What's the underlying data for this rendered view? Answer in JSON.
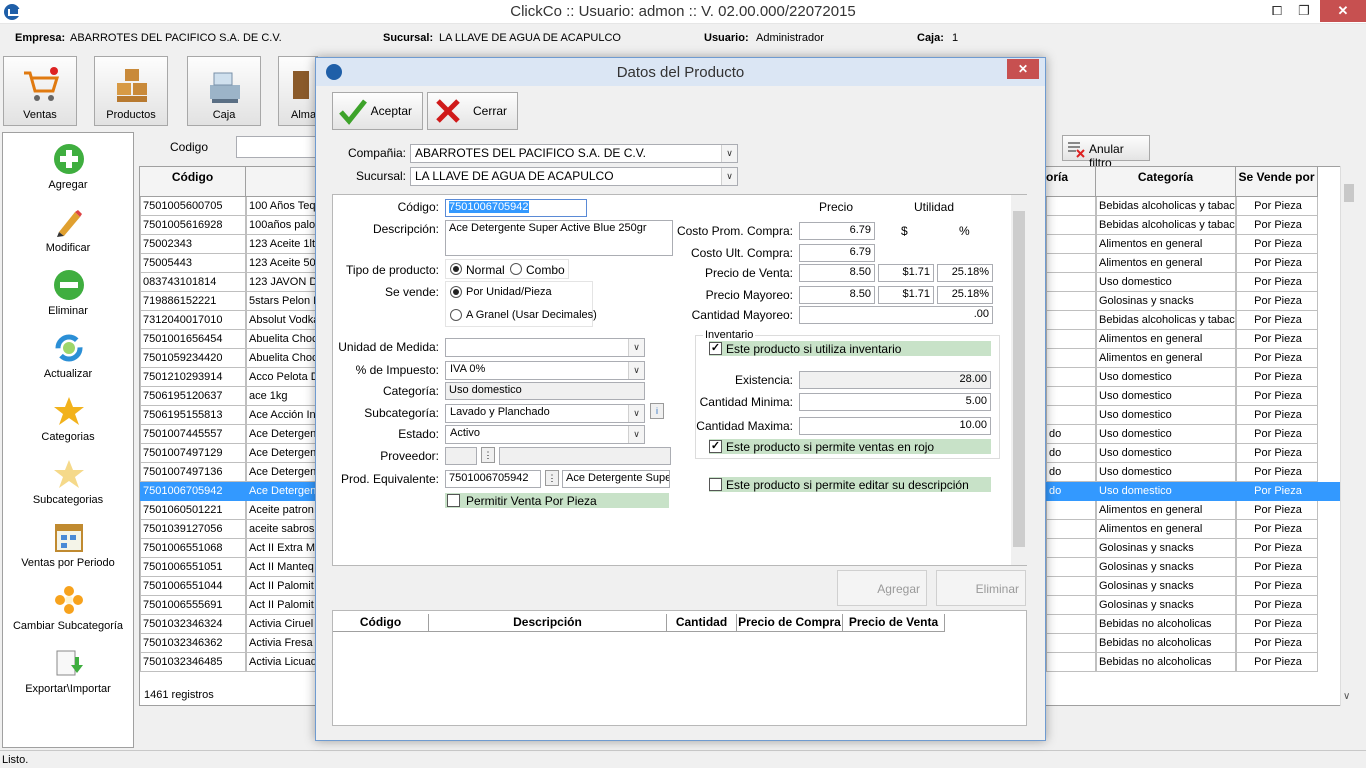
{
  "window": {
    "title": "ClickCo :: Usuario: admon :: V. 02.00.000/22072015",
    "minimize": "⧠",
    "maximize": "❐",
    "close": "✕"
  },
  "infobar": {
    "empresa_label": "Empresa:",
    "empresa": "ABARROTES DEL PACIFICO S.A. DE C.V.",
    "sucursal_label": "Sucursal:",
    "sucursal": "LA LLAVE DE AGUA DE ACAPULCO",
    "usuario_label": "Usuario:",
    "usuario": "Administrador",
    "caja_label": "Caja:",
    "caja": "1"
  },
  "toolbar": {
    "ventas": "Ventas",
    "productos": "Productos",
    "caja": "Caja",
    "almacen": "Alma"
  },
  "sidebar": [
    {
      "label": "Agregar",
      "icon": "plus-circle-icon"
    },
    {
      "label": "Modificar",
      "icon": "pencil-icon"
    },
    {
      "label": "Eliminar",
      "icon": "minus-circle-icon"
    },
    {
      "label": "Actualizar",
      "icon": "refresh-icon"
    },
    {
      "label": "Categorias",
      "icon": "star-icon"
    },
    {
      "label": "Subcategorias",
      "icon": "star-faded-icon"
    },
    {
      "label": "Ventas por Periodo",
      "icon": "calendar-icon"
    },
    {
      "label": "Cambiar Subcategoría",
      "icon": "flower-icon"
    },
    {
      "label": "Exportar\\Importar",
      "icon": "export-icon"
    }
  ],
  "filter": {
    "codigo_label": "Codigo",
    "anular": "Anular filtro"
  },
  "grid": {
    "headers": {
      "codigo": "Código",
      "categoria_partial": "oría",
      "categoria": "Categoría",
      "vende": "Se Vende por"
    },
    "rows": [
      {
        "codigo": "7501005600705",
        "desc": "100 Años Teq",
        "mid": "",
        "cat": "Bebidas alcoholicas y tabaco",
        "vende": "Por Pieza"
      },
      {
        "codigo": "7501005616928",
        "desc": "100años palor",
        "mid": "",
        "cat": "Bebidas alcoholicas y tabaco",
        "vende": "Por Pieza"
      },
      {
        "codigo": "75002343",
        "desc": "123 Aceite 1lt",
        "mid": "",
        "cat": "Alimentos en general",
        "vende": "Por Pieza"
      },
      {
        "codigo": "75005443",
        "desc": "123 Aceite 500",
        "mid": "",
        "cat": "Alimentos en general",
        "vende": "Por Pieza"
      },
      {
        "codigo": "083743101814",
        "desc": "123 JAVON DE",
        "mid": "",
        "cat": "Uso domestico",
        "vende": "Por Pieza"
      },
      {
        "codigo": "719886152221",
        "desc": "5stars Pelon P",
        "mid": "",
        "cat": "Golosinas y snacks",
        "vende": "Por Pieza"
      },
      {
        "codigo": "7312040017010",
        "desc": "Absolut Vodka",
        "mid": "",
        "cat": "Bebidas alcoholicas y tabaco",
        "vende": "Por Pieza"
      },
      {
        "codigo": "7501001656454",
        "desc": "Abuelita Choc",
        "mid": "",
        "cat": "Alimentos en general",
        "vende": "Por Pieza"
      },
      {
        "codigo": "7501059234420",
        "desc": "Abuelita Choc",
        "mid": "",
        "cat": "Alimentos en general",
        "vende": "Por Pieza"
      },
      {
        "codigo": "7501210293914",
        "desc": "Acco Pelota De",
        "mid": "",
        "cat": "Uso domestico",
        "vende": "Por Pieza"
      },
      {
        "codigo": "7506195120637",
        "desc": "ace 1kg",
        "mid": "",
        "cat": "Uso domestico",
        "vende": "Por Pieza"
      },
      {
        "codigo": "7506195155813",
        "desc": "Ace Acción Ins",
        "mid": "",
        "cat": "Uso domestico",
        "vende": "Por Pieza"
      },
      {
        "codigo": "7501007445557",
        "desc": "Ace Detergent",
        "mid": "do",
        "cat": "Uso domestico",
        "vende": "Por Pieza"
      },
      {
        "codigo": "7501007497129",
        "desc": "Ace Detergent",
        "mid": "do",
        "cat": "Uso domestico",
        "vende": "Por Pieza"
      },
      {
        "codigo": "7501007497136",
        "desc": "Ace Detergent",
        "mid": "do",
        "cat": "Uso domestico",
        "vende": "Por Pieza"
      },
      {
        "codigo": "7501006705942",
        "desc": "Ace Detergent",
        "mid": "do",
        "cat": "Uso domestico",
        "vende": "Por Pieza"
      },
      {
        "codigo": "7501060501221",
        "desc": "Aceite patron",
        "mid": "",
        "cat": "Alimentos en general",
        "vende": "Por Pieza"
      },
      {
        "codigo": "7501039127056",
        "desc": "aceite sabros",
        "mid": "",
        "cat": "Alimentos en general",
        "vende": "Por Pieza"
      },
      {
        "codigo": "7501006551068",
        "desc": "Act II Extra M",
        "mid": "",
        "cat": "Golosinas y snacks",
        "vende": "Por Pieza"
      },
      {
        "codigo": "7501006551051",
        "desc": "Act II Manteq",
        "mid": "",
        "cat": "Golosinas y snacks",
        "vende": "Por Pieza"
      },
      {
        "codigo": "7501006551044",
        "desc": "Act II Palomit",
        "mid": "",
        "cat": "Golosinas y snacks",
        "vende": "Por Pieza"
      },
      {
        "codigo": "7501006555691",
        "desc": "Act II Palomit",
        "mid": "",
        "cat": "Golosinas y snacks",
        "vende": "Por Pieza"
      },
      {
        "codigo": "7501032346324",
        "desc": "Activia Ciruel",
        "mid": "",
        "cat": "Bebidas no alcoholicas",
        "vende": "Por Pieza"
      },
      {
        "codigo": "7501032346362",
        "desc": "Activia Fresa",
        "mid": "",
        "cat": "Bebidas no alcoholicas",
        "vende": "Por Pieza"
      },
      {
        "codigo": "7501032346485",
        "desc": "Activia Licuad",
        "mid": "",
        "cat": "Bebidas no alcoholicas",
        "vende": "Por Pieza"
      }
    ],
    "selected_index": 15,
    "count": "1461 registros"
  },
  "status": "Listo.",
  "dialog": {
    "title": "Datos del Producto",
    "close": "✕",
    "aceptar": "Aceptar",
    "cerrar": "Cerrar",
    "compania_label": "Compañia:",
    "compania": "ABARROTES DEL PACIFICO S.A. DE C.V.",
    "sucursal_label": "Sucursal:",
    "sucursal": "LA LLAVE DE AGUA DE ACAPULCO",
    "codigo_label": "Código:",
    "codigo": "7501006705942",
    "descripcion_label": "Descripción:",
    "descripcion": "Ace Detergente Super Active Blue 250gr",
    "tipo_label": "Tipo de producto:",
    "tipo_normal": "Normal",
    "tipo_combo": "Combo",
    "vende_label": "Se vende:",
    "vende_unidad": "Por Unidad/Pieza",
    "vende_granel": "A Granel (Usar Decimales)",
    "unidad_label": "Unidad de Medida:",
    "unidad": "",
    "impuesto_label": "% de Impuesto:",
    "impuesto": "IVA 0%",
    "categoria_label": "Categoría:",
    "categoria": "Uso domestico",
    "subcategoria_label": "Subcategoría:",
    "subcategoria": "Lavado y Planchado",
    "estado_label": "Estado:",
    "estado": "Activo",
    "proveedor_label": "Proveedor:",
    "equivalente_label": "Prod. Equivalente:",
    "equivalente_codigo": "7501006705942",
    "equivalente_desc": "Ace Detergente Super",
    "venta_pieza": "Permitir Venta Por Pieza",
    "precio_header": "Precio",
    "utilidad_header": "Utilidad",
    "currency": "$",
    "percent": "%",
    "costo_prom_label": "Costo Prom. Compra:",
    "costo_prom": "6.79",
    "costo_ult_label": "Costo Ult. Compra:",
    "costo_ult": "6.79",
    "precio_venta_label": "Precio de Venta:",
    "precio_venta": "8.50",
    "precio_venta_util": "$1.71",
    "precio_venta_pct": "25.18%",
    "precio_mayoreo_label": "Precio Mayoreo:",
    "precio_mayoreo": "8.50",
    "precio_mayoreo_util": "$1.71",
    "precio_mayoreo_pct": "25.18%",
    "cantidad_mayoreo_label": "Cantidad Mayoreo:",
    "cantidad_mayoreo": ".00",
    "inventario_label": "Inventario",
    "usa_inventario": "Este producto si utiliza inventario",
    "existencia_label": "Existencia:",
    "existencia": "28.00",
    "cant_min_label": "Cantidad Minima:",
    "cant_min": "5.00",
    "cant_max_label": "Cantidad Maxima:",
    "cant_max": "10.00",
    "ventas_rojo": "Este producto si permite ventas en rojo",
    "editar_desc": "Este producto si permite editar su descripción",
    "agregar": "Agregar",
    "eliminar": "Eliminar",
    "detail_headers": [
      "Código",
      "Descripción",
      "Cantidad",
      "Precio de Compra",
      "Precio de Venta"
    ]
  }
}
